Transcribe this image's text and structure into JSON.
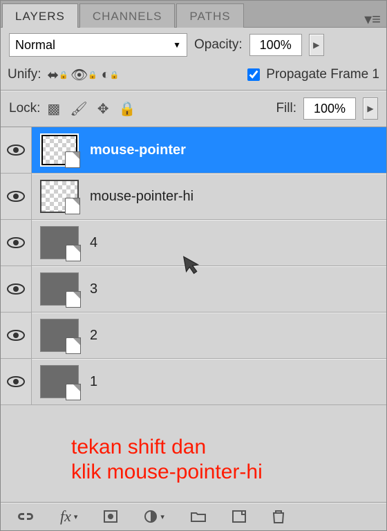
{
  "tabs": {
    "layers": "LAYERS",
    "channels": "CHANNELS",
    "paths": "PATHS"
  },
  "blend": {
    "mode": "Normal",
    "opacity_label": "Opacity:",
    "opacity_value": "100%"
  },
  "unify": {
    "label": "Unify:",
    "propagate_label": "Propagate Frame 1"
  },
  "lock": {
    "label": "Lock:",
    "fill_label": "Fill:",
    "fill_value": "100%"
  },
  "layers": [
    {
      "name": "mouse-pointer",
      "selected": true,
      "thumb": "checker"
    },
    {
      "name": "mouse-pointer-hi",
      "selected": false,
      "thumb": "checker"
    },
    {
      "name": "4",
      "selected": false,
      "thumb": "solid"
    },
    {
      "name": "3",
      "selected": false,
      "thumb": "solid"
    },
    {
      "name": "2",
      "selected": false,
      "thumb": "solid"
    },
    {
      "name": "1",
      "selected": false,
      "thumb": "solid"
    }
  ],
  "annotation": {
    "line1": "tekan shift dan",
    "line2": "klik mouse-pointer-hi"
  },
  "bottom": {
    "link": "⌘",
    "fx": "fx",
    "mask": "◻",
    "adjust": "◐",
    "folder": "▭",
    "new": "▣",
    "trash": "🗑"
  }
}
